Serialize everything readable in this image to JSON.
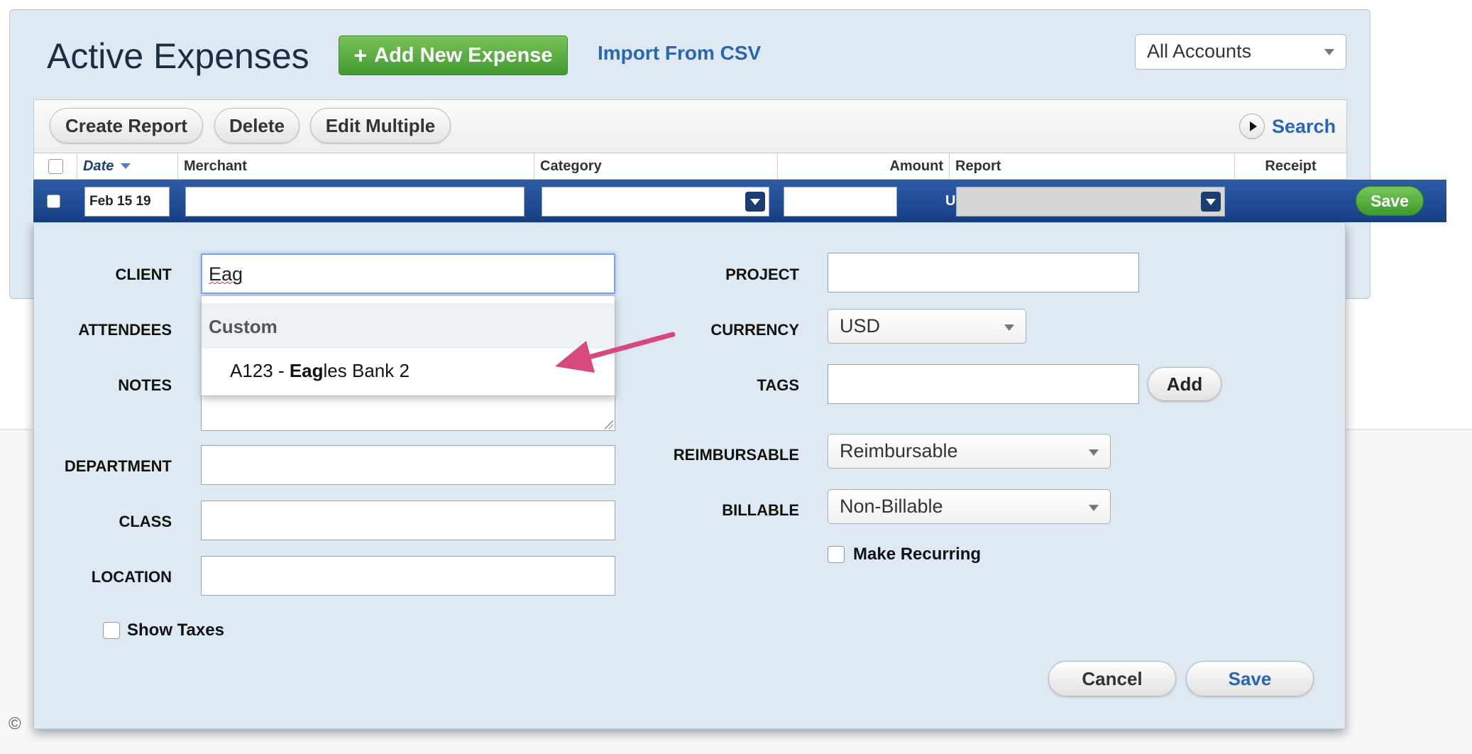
{
  "header": {
    "title": "Active Expenses",
    "add_button": "Add New Expense",
    "add_icon": "+",
    "import_link": "Import From CSV",
    "accounts_select": "All Accounts"
  },
  "toolbar": {
    "create_report": "Create Report",
    "delete": "Delete",
    "edit_multiple": "Edit Multiple",
    "search": "Search"
  },
  "table": {
    "columns": {
      "date": "Date",
      "merchant": "Merchant",
      "category": "Category",
      "amount": "Amount",
      "report": "Report",
      "receipt": "Receipt"
    },
    "edit_row": {
      "date": "Feb 15 19",
      "merchant": "",
      "category": "",
      "amount": "",
      "currency": "USD",
      "report": "",
      "save": "Save"
    }
  },
  "form": {
    "client_label": "CLIENT",
    "client_value": "Eag",
    "attendees_label": "ATTENDEES",
    "notes_label": "NOTES",
    "department_label": "DEPARTMENT",
    "class_label": "CLASS",
    "location_label": "LOCATION",
    "show_taxes": "Show Taxes",
    "project_label": "PROJECT",
    "currency_label": "CURRENCY",
    "currency_value": "USD",
    "tags_label": "TAGS",
    "tags_add": "Add",
    "reimbursable_label": "REIMBURSABLE",
    "reimbursable_value": "Reimbursable",
    "billable_label": "BILLABLE",
    "billable_value": "Non-Billable",
    "make_recurring": "Make Recurring",
    "cancel": "Cancel",
    "save": "Save"
  },
  "client_dropdown": {
    "group": "Custom",
    "item_prefix": "A123 - ",
    "item_match": "Eag",
    "item_rest": "les Bank 2"
  },
  "colors": {
    "accent_green": "#4ba536",
    "link_blue": "#2a66b0",
    "row_blue": "#1f4a92",
    "arrow_pink": "#d6497c"
  }
}
